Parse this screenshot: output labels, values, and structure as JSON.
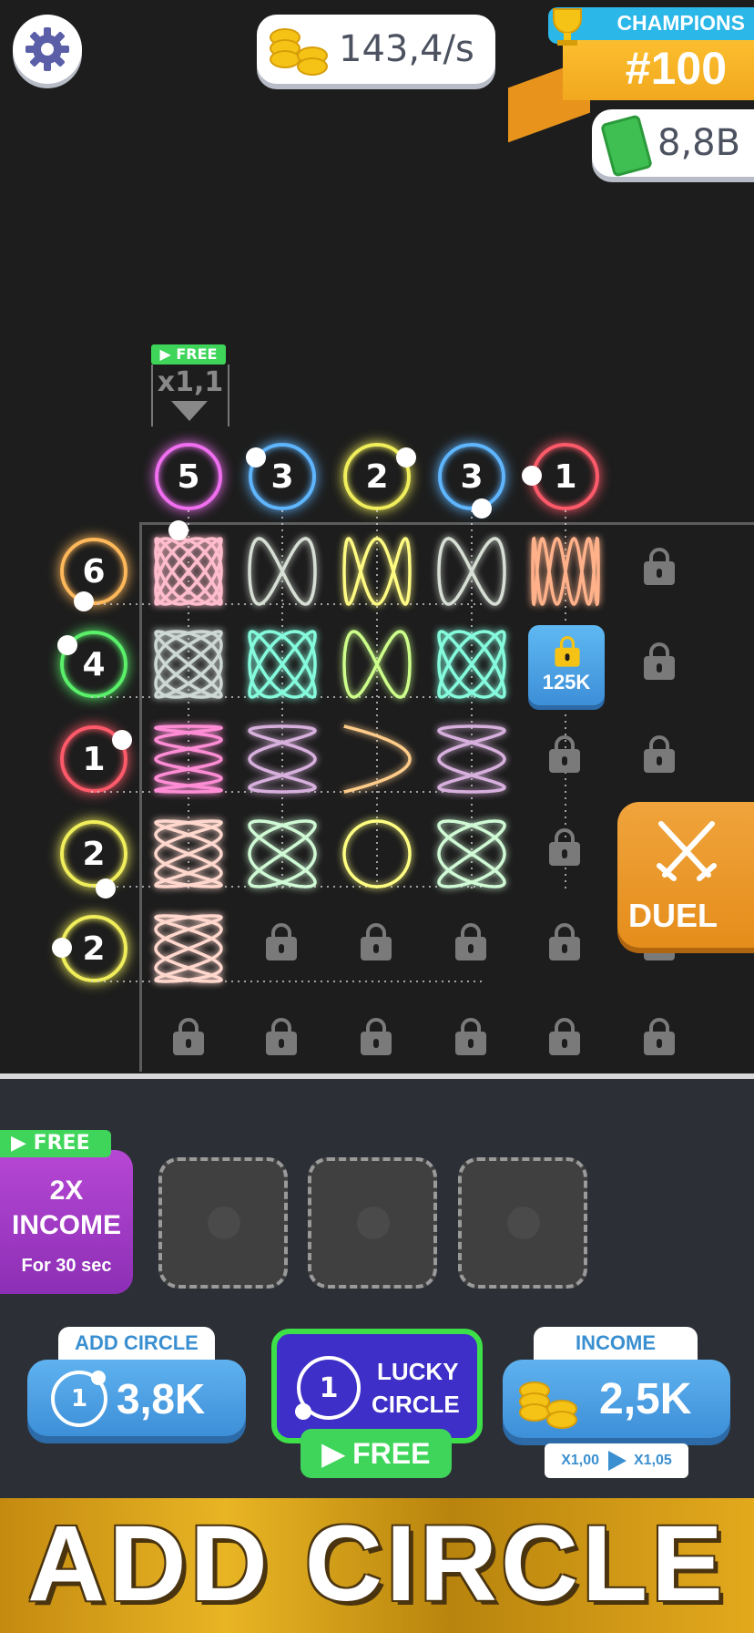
{
  "header": {
    "income_rate": "143,4/s",
    "champions_label": "CHAMPIONS",
    "champions_rank": "#100",
    "cash": "8,8B"
  },
  "multiplier": {
    "free_label": "FREE",
    "value": "x1,1"
  },
  "top_circles": [
    {
      "value": "5",
      "color": "#f06ff0"
    },
    {
      "value": "3",
      "color": "#5fb6ff"
    },
    {
      "value": "2",
      "color": "#f0ee5a"
    },
    {
      "value": "3",
      "color": "#5fb6ff"
    },
    {
      "value": "1",
      "color": "#ff5a6a"
    }
  ],
  "side_circles": [
    {
      "value": "6",
      "color": "#ffb85a"
    },
    {
      "value": "4",
      "color": "#5af06a"
    },
    {
      "value": "1",
      "color": "#ff5a6a"
    },
    {
      "value": "2",
      "color": "#f0ee5a"
    },
    {
      "value": "2",
      "color": "#f0ee5a"
    }
  ],
  "unlock_cost": "125K",
  "duel_label": "DUEL",
  "boost": {
    "free_label": "FREE",
    "line1": "2X",
    "line2": "INCOME",
    "line3": "For 30 sec"
  },
  "buttons": {
    "add_circle_label": "ADD CIRCLE",
    "add_circle_level": "1",
    "add_circle_cost": "3,8K",
    "lucky_level": "1",
    "lucky_line1": "LUCKY",
    "lucky_line2": "CIRCLE",
    "lucky_free": "▶ FREE",
    "income_label": "INCOME",
    "income_cost": "2,5K",
    "income_from": "X1,00",
    "income_to": "X1,05"
  },
  "banner": "ADD CIRCLE",
  "colors": {
    "background": "#1d1d1d",
    "accent_green": "#3fd55a",
    "accent_blue": "#3d8fd8",
    "accent_orange": "#e58d1b"
  }
}
